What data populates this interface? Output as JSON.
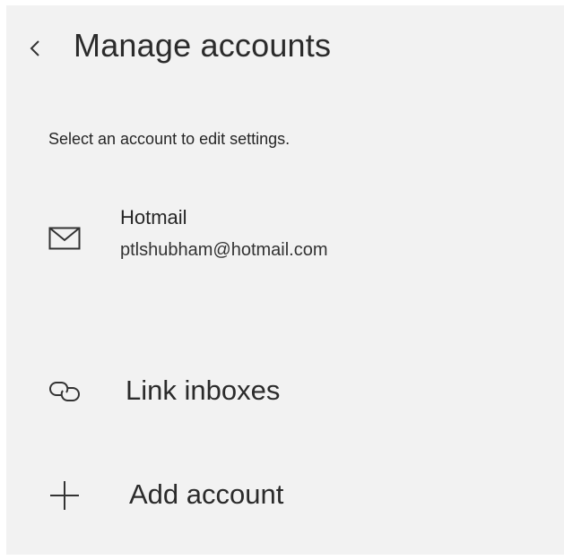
{
  "header": {
    "back_icon": "chevron-left-icon",
    "title": "Manage accounts"
  },
  "instruction": "Select an account to edit settings.",
  "accounts": [
    {
      "icon": "mail-icon",
      "name": "Hotmail",
      "email": "ptlshubham@hotmail.com"
    }
  ],
  "actions": {
    "link_inboxes": {
      "icon": "link-icon",
      "label": "Link inboxes"
    },
    "add_account": {
      "icon": "plus-icon",
      "label": "Add account"
    }
  },
  "colors": {
    "panel_background": "#f2f2f2",
    "page_background": "#ffffff",
    "text": "#2b2b2b"
  }
}
